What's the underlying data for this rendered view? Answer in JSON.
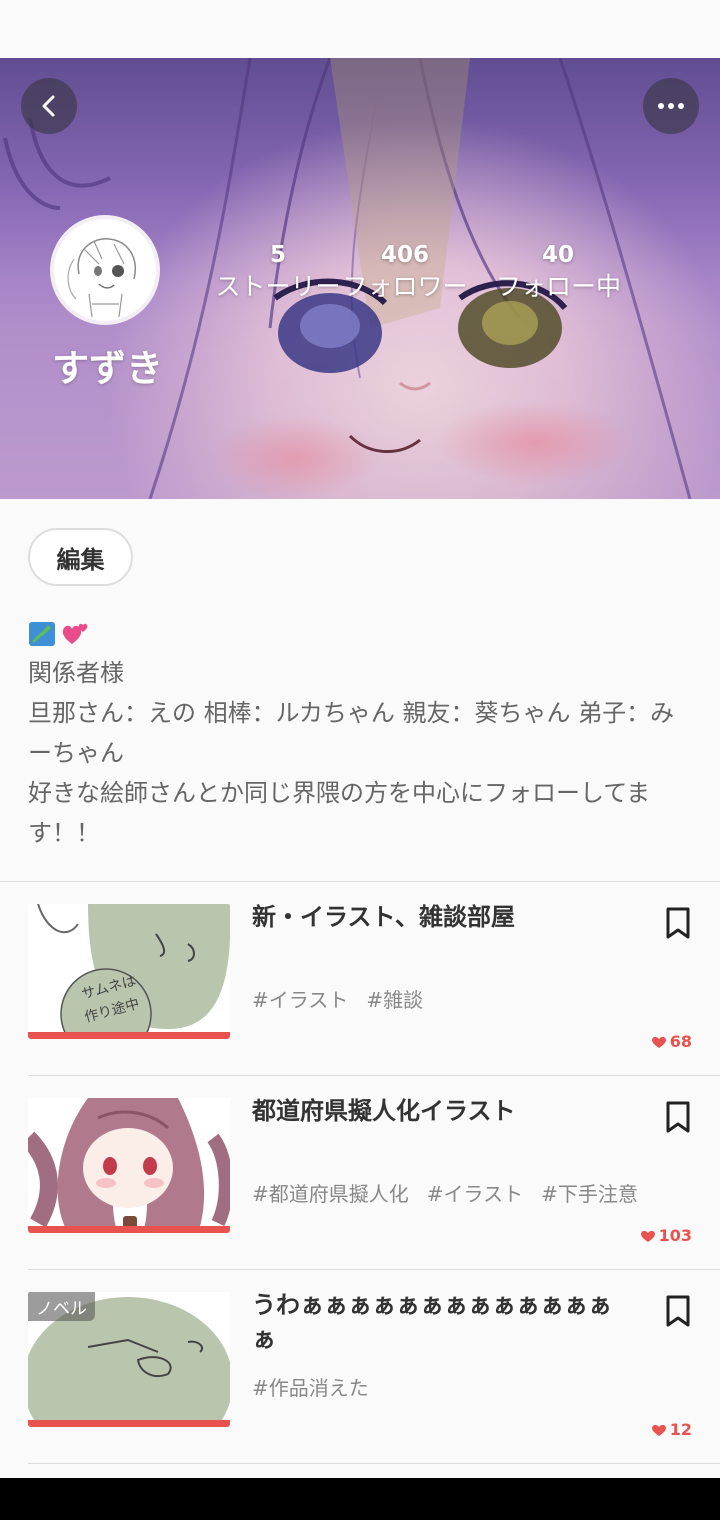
{
  "profile": {
    "username": "すずき",
    "stats": {
      "stories": {
        "value": "5",
        "label": "ストーリー"
      },
      "followers": {
        "value": "406",
        "label": "フォロワー"
      },
      "following": {
        "value": "40",
        "label": "フォロー中"
      }
    },
    "edit_label": "編集"
  },
  "bio": {
    "emojis": [
      "japan-map-emoji",
      "two-hearts-emoji"
    ],
    "lines": [
      "関係者様",
      "旦那さん：えの  相棒：ルカちゃん  親友：葵ちゃん  弟子：みーちゃん",
      "好きな絵師さんとか同じ界隈の方を中心にフォローしてます！！"
    ]
  },
  "stories": [
    {
      "title": "新・イラスト、雑談部屋",
      "tags": [
        "#イラスト",
        "#雑談"
      ],
      "likes": "68",
      "badge": ""
    },
    {
      "title": "都道府県擬人化イラスト",
      "tags": [
        "#都道府県擬人化",
        "#イラスト",
        "#下手注意"
      ],
      "likes": "103",
      "badge": ""
    },
    {
      "title": "うわぁぁぁぁぁぁぁぁぁぁぁぁぁぁ",
      "tags": [
        "#作品消えた"
      ],
      "likes": "12",
      "badge": "ノベル"
    }
  ],
  "colors": {
    "accent": "#e8534f",
    "text": "#333333",
    "muted": "#888888"
  },
  "icons": {
    "back": "chevron-left-icon",
    "more": "more-horizontal-icon",
    "bookmark": "bookmark-icon",
    "heart": "heart-icon"
  }
}
